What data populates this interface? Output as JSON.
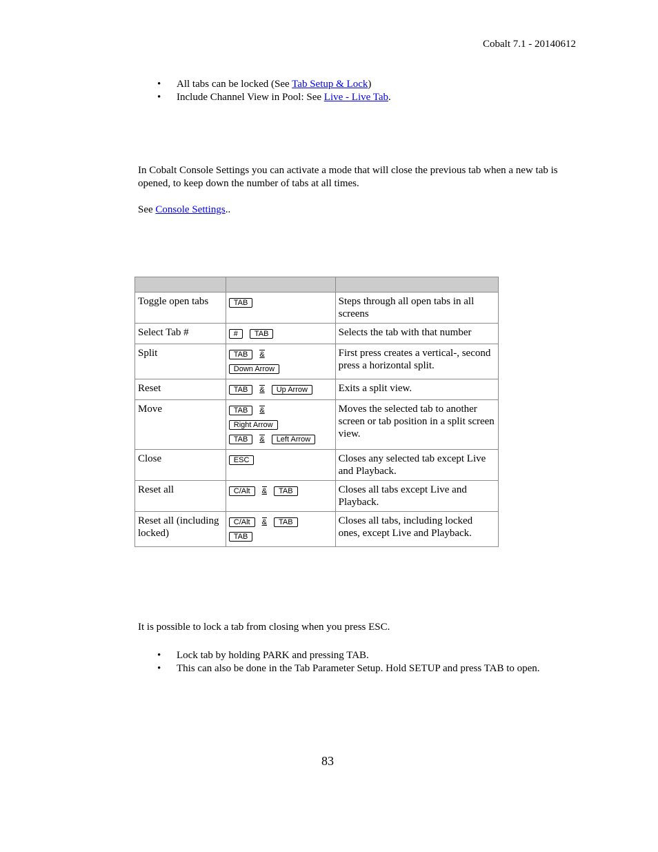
{
  "header": {
    "version": "Cobalt 7.1 - 20140612"
  },
  "top_bullets": [
    {
      "text_before": "All tabs can be locked (See ",
      "link": "Tab Setup & Lock",
      "text_after": ")"
    },
    {
      "text_before": "Include Channel View in Pool: See ",
      "link": "Live - Live Tab",
      "text_after": "."
    }
  ],
  "console_section": {
    "paragraph": "In Cobalt Console Settings you can activate a mode that will close the previous tab when a new tab is opened, to keep down the number of tabs at all times.",
    "see_prefix": "See ",
    "see_link": "Console Settings",
    "see_suffix": ".."
  },
  "shortcut_table": {
    "headers": [
      "",
      "",
      ""
    ],
    "rows": [
      {
        "action": "Toggle open tabs",
        "keys": [
          [
            "TAB"
          ]
        ],
        "description": "Steps through all open tabs in all screens"
      },
      {
        "action": "Select Tab #",
        "keys": [
          [
            "#",
            "TAB"
          ]
        ],
        "description": "Selects the tab with that number"
      },
      {
        "action": "Split",
        "keys": [
          [
            "TAB",
            "&"
          ],
          [
            "Down Arrow"
          ]
        ],
        "description": "First press creates a vertical-, second press a horizontal split."
      },
      {
        "action": "Reset",
        "keys": [
          [
            "TAB",
            "&",
            "Up Arrow"
          ]
        ],
        "description": "Exits a split view."
      },
      {
        "action": "Move",
        "keys": [
          [
            "TAB",
            "&"
          ],
          [
            "Right Arrow"
          ],
          [
            "TAB",
            "&",
            "Left Arrow"
          ]
        ],
        "description": "Moves the selected tab to another screen or tab position in a split screen view."
      },
      {
        "action": "Close",
        "keys": [
          [
            "ESC"
          ]
        ],
        "description": "Closes any selected tab except Live and Playback."
      },
      {
        "action": "Reset all",
        "keys": [
          [
            "C/Alt",
            "&",
            "TAB"
          ]
        ],
        "description": "Closes all tabs except Live and Playback."
      },
      {
        "action": "Reset all (including locked)",
        "keys": [
          [
            "C/Alt",
            "&",
            "TAB"
          ],
          [
            "TAB"
          ]
        ],
        "description": "Closes all tabs, including locked ones, except Live and Playback."
      }
    ]
  },
  "lock_section": {
    "paragraph": "It is possible to lock a tab from closing when you press ESC.",
    "bullets": [
      "Lock tab by holding PARK and pressing TAB.",
      "This can also be done in the Tab Parameter Setup. Hold SETUP and press TAB to open."
    ]
  },
  "footer": {
    "page_number": "83"
  }
}
